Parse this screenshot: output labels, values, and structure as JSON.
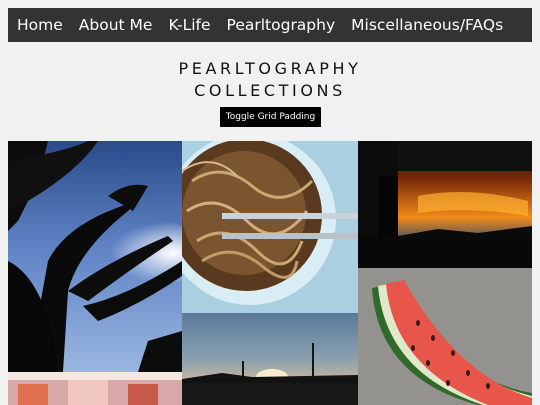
{
  "nav": {
    "items": [
      {
        "label": "Home"
      },
      {
        "label": "About Me"
      },
      {
        "label": "K-Life"
      },
      {
        "label": "Pearltography"
      },
      {
        "label": "Miscellaneous/FAQs"
      }
    ]
  },
  "header": {
    "title_line1": "PEARLTOGRAPHY",
    "title_line2": "COLLECTIONS"
  },
  "toolbar": {
    "toggle_label": "Toggle Grid Padding"
  },
  "gallery": {
    "photos": [
      {
        "icon": "banana-leaves-silhouette-photo"
      },
      {
        "icon": "noodle-bowl-chopsticks-photo"
      },
      {
        "icon": "sunset-buildings-photo"
      },
      {
        "icon": "drink-glasses-photo"
      },
      {
        "icon": "sunset-street-photo"
      },
      {
        "icon": "watermelon-slice-photo"
      }
    ]
  },
  "colors": {
    "nav_bg": "#333333",
    "page_bg": "#f1f1f1",
    "button_bg": "#000000"
  }
}
